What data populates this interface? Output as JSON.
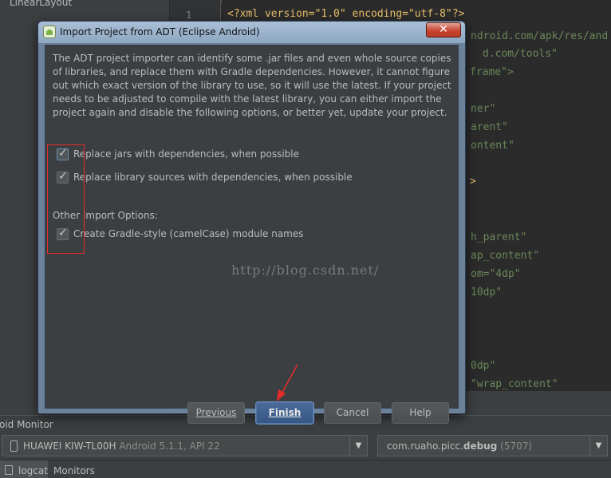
{
  "ide": {
    "tree_item": "LinearLayout",
    "line_number": "1",
    "code_lines": [
      {
        "text": "<?xml version=\"1.0\" encoding=\"utf-8\"?>"
      },
      {
        "text": "ndroid.com/apk/res/and"
      },
      {
        "text": "d.com/tools\""
      },
      {
        "text": "frame\">"
      },
      {
        "text": "ner\""
      },
      {
        "text": "arent\""
      },
      {
        "text": "ontent\""
      },
      {
        "text": ">"
      },
      {
        "text": "h_parent\""
      },
      {
        "text": "ap_content\""
      },
      {
        "text": "om=\"4dp\""
      },
      {
        "text": "10dp\""
      },
      {
        "text": "0dp\""
      },
      {
        "text": "\"wrap_content\""
      }
    ]
  },
  "dialog": {
    "title": "Import Project from ADT (Eclipse Android)",
    "close_label": "✕",
    "description": "The ADT project importer can identify some .jar files and even whole source copies of libraries, and replace them with Gradle dependencies. However, it cannot figure out which exact version of the library to use, so it will use the latest. If your project needs to be adjusted to compile with the latest library, you can either import the project again and disable the following options, or better yet, update your project.",
    "options": [
      {
        "label": "Replace jars with dependencies, when possible",
        "checked": true
      },
      {
        "label": "Replace library sources with dependencies, when possible",
        "checked": true
      }
    ],
    "other_section_label": "Other Import Options:",
    "other_options": [
      {
        "label": "Create Gradle-style (camelCase) module names",
        "checked": true
      }
    ],
    "watermark": "http://blog.csdn.net/",
    "buttons": {
      "previous": "Previous",
      "finish": "Finish",
      "cancel": "Cancel",
      "help": "Help"
    }
  },
  "monitor": {
    "title": "oid Monitor",
    "device_name": "HUAWEI KIW-TL00H",
    "device_info": "Android 5.1.1, API 22",
    "process_name": "com.ruaho.picc.",
    "process_name_bold": "debug",
    "process_pid": "(5707)",
    "tabs": [
      "logcat",
      "Monitors"
    ]
  },
  "colors": {
    "annotation": "#e52b2b",
    "primary_button": "#3f6190"
  }
}
